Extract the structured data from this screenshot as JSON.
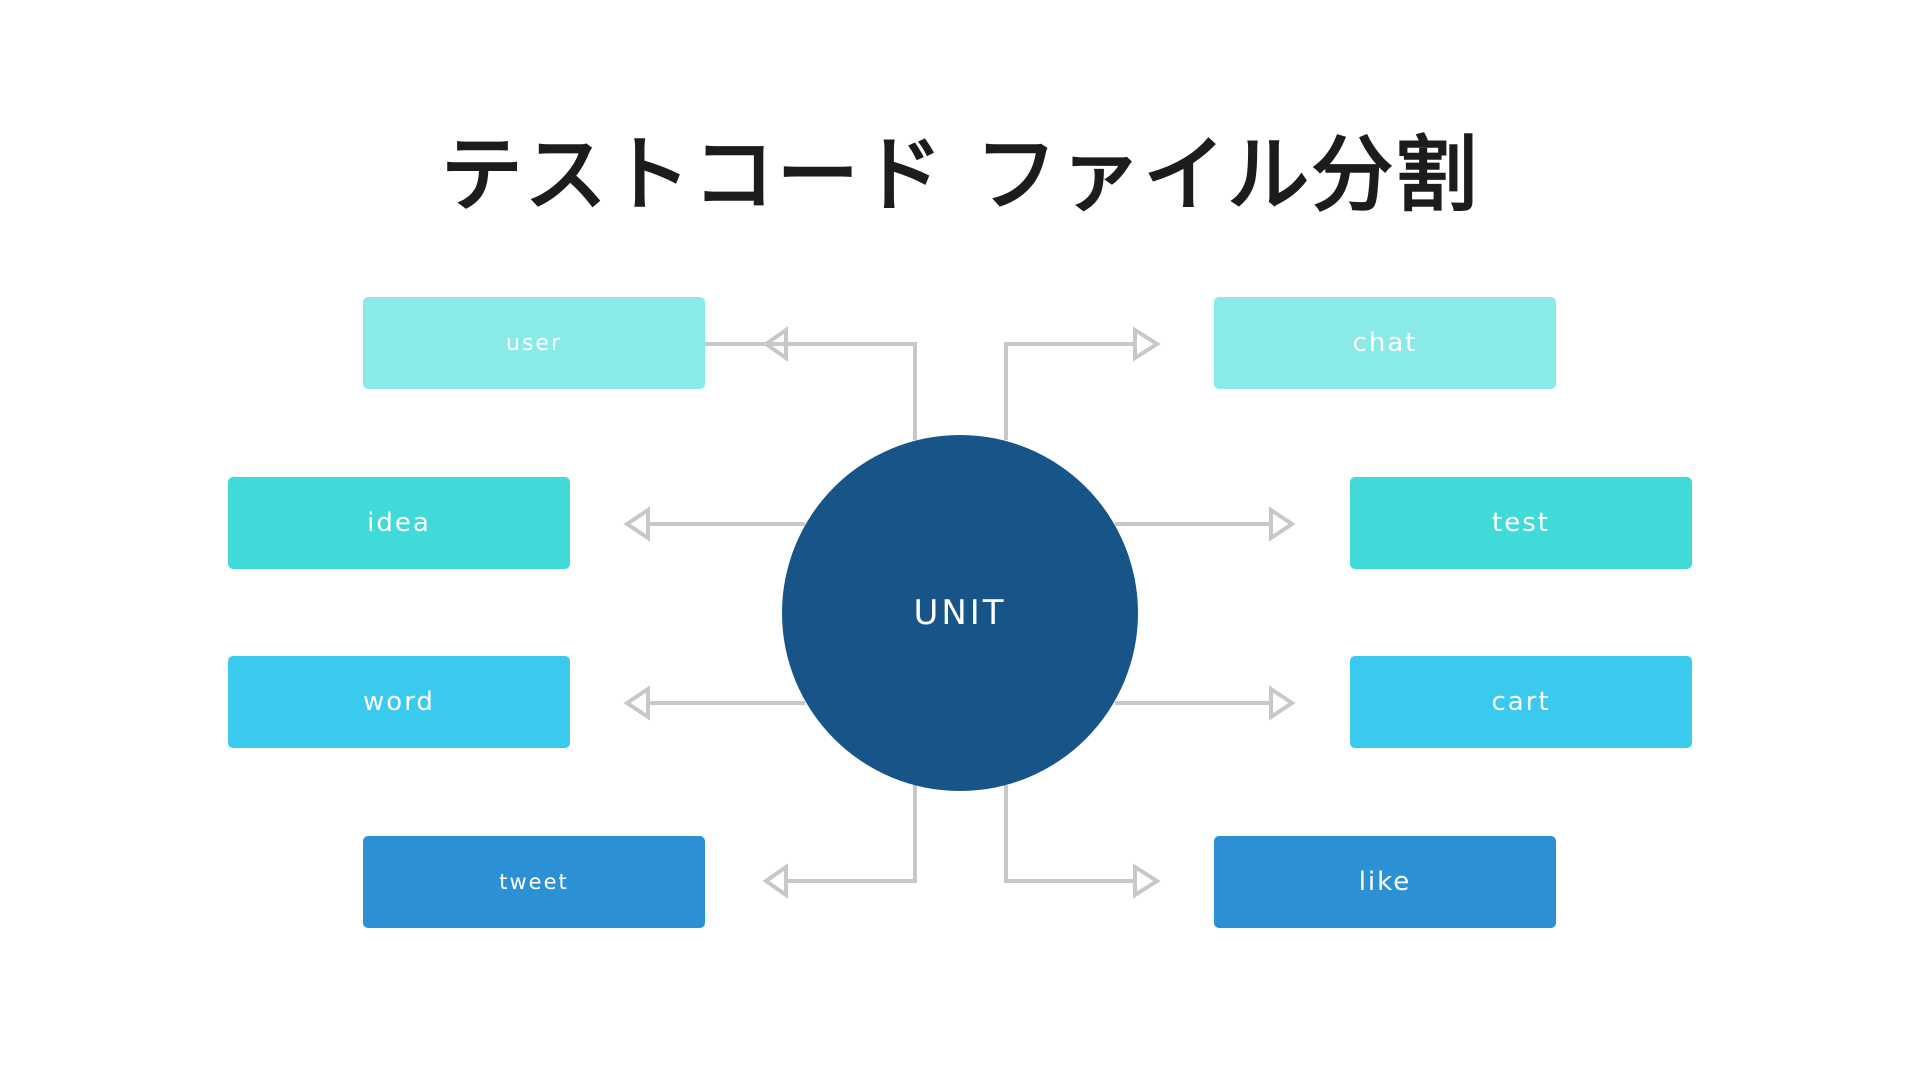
{
  "title": "テストコード ファイル分割",
  "hub": {
    "label": "UNIT",
    "color": "#175488"
  },
  "nodes": {
    "user": {
      "label": "user",
      "color": "#8aeae8"
    },
    "chat": {
      "label": "chat",
      "color": "#8aeae8"
    },
    "idea": {
      "label": "idea",
      "color": "#40dbd8"
    },
    "test": {
      "label": "test",
      "color": "#40dbd8"
    },
    "word": {
      "label": "word",
      "color": "#3acaee"
    },
    "cart": {
      "label": "cart",
      "color": "#3acaee"
    },
    "tweet": {
      "label": "tweet",
      "color": "#2c91d4"
    },
    "like": {
      "label": "like",
      "color": "#2c91d4"
    }
  },
  "connector_color": "#c8c8c8"
}
